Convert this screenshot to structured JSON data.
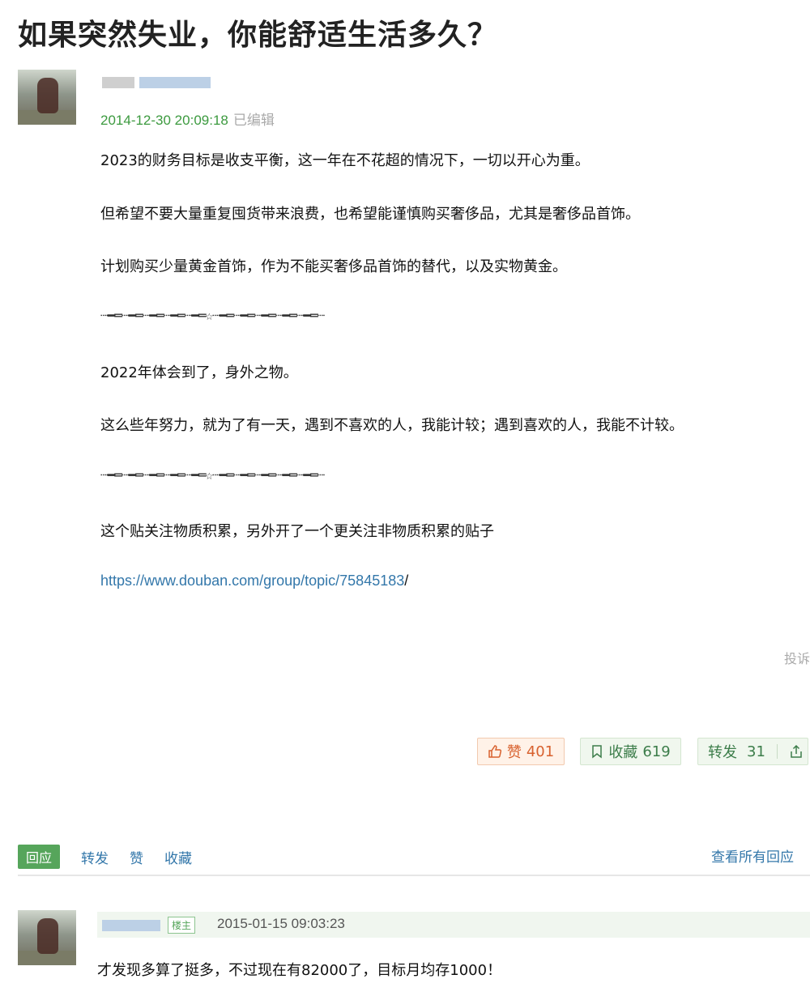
{
  "post": {
    "title": "如果突然失业，你能舒适生活多久？",
    "timestamp": "2014-12-30 20:09:18",
    "edited_label": "已编辑",
    "paragraphs": [
      "2023的财务目标是收支平衡，这一年在不花超的情况下，一切以开心为重。",
      "但希望不要大量重复囤货带来浪费，也希望能谨慎购买奢侈品，尤其是奢侈品首饰。",
      "计划购买少量黄金首饰，作为不能买奢侈品首饰的替代，以及实物黄金。",
      "2022年体会到了，身外之物。",
      "这么些年努力，就为了有一天，遇到不喜欢的人，我能计较；遇到喜欢的人，我能不计较。",
      "这个贴关注物质积累，另外开了一个更关注非物质积累的贴子"
    ],
    "divider": "┈━═┈━═┈━═┈━═┈━═☆┈━═┈━═┈━═┈━═┈━═┈",
    "link": "https://www.douban.com/group/topic/75845183",
    "link_tail": "/",
    "report_label": "投诉"
  },
  "reactions": {
    "like_label": "赞",
    "like_count": "401",
    "fav_label": "收藏",
    "fav_count": "619",
    "forward_label": "转发",
    "forward_count": "31"
  },
  "action_bar": {
    "reply_label": "回应",
    "forward_label": "转发",
    "like_label": "赞",
    "fav_label": "收藏",
    "view_all_label": "查看所有回应"
  },
  "reply": {
    "badge": "楼主",
    "timestamp": "2015-01-15 09:03:23",
    "text": "才发现多算了挺多，不过现在有82000了，目标月均存1000！"
  },
  "colors": {
    "accent_green": "#3c9a3f",
    "link_blue": "#3377aa",
    "like_orange": "#d8612e"
  },
  "icons": [
    "thumbs-up-icon",
    "bookmark-icon",
    "share-icon"
  ]
}
